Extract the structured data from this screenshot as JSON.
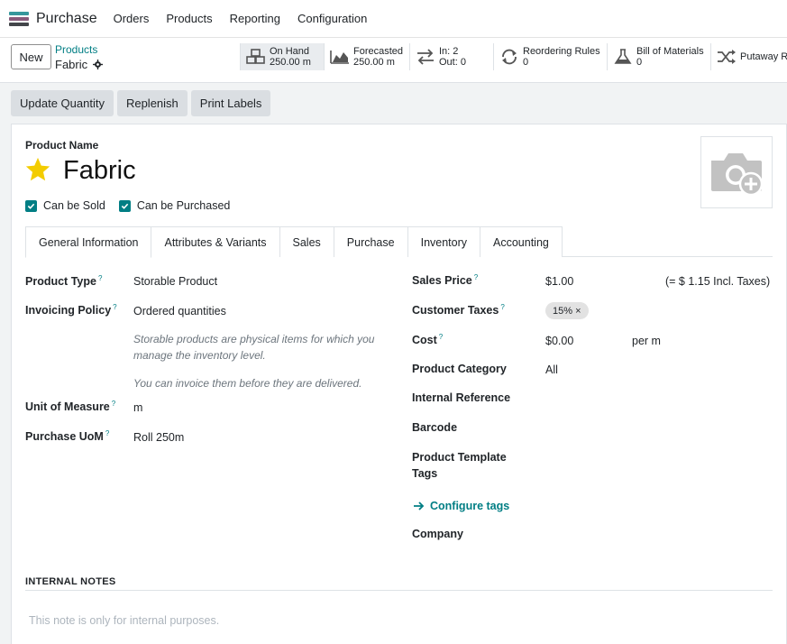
{
  "navbar": {
    "app_name": "Purchase",
    "logo_colors": [
      "#35979c",
      "#875a7b",
      "#212529"
    ],
    "menu": [
      "Orders",
      "Products",
      "Reporting",
      "Configuration"
    ]
  },
  "control": {
    "new_label": "New",
    "breadcrumb_parent": "Products",
    "breadcrumb_current": "Fabric",
    "smart_buttons": [
      {
        "icon": "cubes-icon",
        "label": "On Hand",
        "value": "250.00 m"
      },
      {
        "icon": "area-chart-icon",
        "label": "Forecasted",
        "value": "250.00 m"
      },
      {
        "icon": "exchange-icon",
        "label": "In: 2",
        "value": "Out: 0"
      },
      {
        "icon": "refresh-icon",
        "label": "Reordering Rules",
        "value": "0"
      },
      {
        "icon": "flask-icon",
        "label": "Bill of Materials",
        "value": "0"
      },
      {
        "icon": "random-icon",
        "label": "Putaway Ru",
        "value": ""
      }
    ]
  },
  "actions": [
    "Update Quantity",
    "Replenish",
    "Print Labels"
  ],
  "form": {
    "product_name_label": "Product Name",
    "product_name": "Fabric",
    "star_color": "#f3cc00",
    "can_be_sold": "Can be Sold",
    "can_be_purchased": "Can be Purchased",
    "tabs": [
      "General Information",
      "Attributes & Variants",
      "Sales",
      "Purchase",
      "Inventory",
      "Accounting"
    ],
    "left": {
      "product_type_label": "Product Type",
      "product_type": "Storable Product",
      "invoicing_policy_label": "Invoicing Policy",
      "invoicing_policy": "Ordered quantities",
      "help_1": "Storable products are physical items for which you manage the inventory level.",
      "help_2": "You can invoice them before they are delivered.",
      "uom_label": "Unit of Measure",
      "uom": "m",
      "purchase_uom_label": "Purchase UoM",
      "purchase_uom": "Roll 250m"
    },
    "right": {
      "sales_price_label": "Sales Price",
      "sales_price": "$1.00",
      "incl_taxes": "(= $ 1.15 Incl. Taxes)",
      "customer_taxes_label": "Customer Taxes",
      "customer_tax_tag": "15% ×",
      "cost_label": "Cost",
      "cost": "$0.00",
      "cost_unit": "per m",
      "category_label": "Product Category",
      "category": "All",
      "internal_ref_label": "Internal Reference",
      "barcode_label": "Barcode",
      "template_tags_label_1": "Product Template",
      "template_tags_label_2": "Tags",
      "configure_tags": "Configure tags",
      "company_label": "Company"
    },
    "notes_title": "INTERNAL NOTES",
    "notes_placeholder": "This note is only for internal purposes."
  },
  "help_marker": "?"
}
